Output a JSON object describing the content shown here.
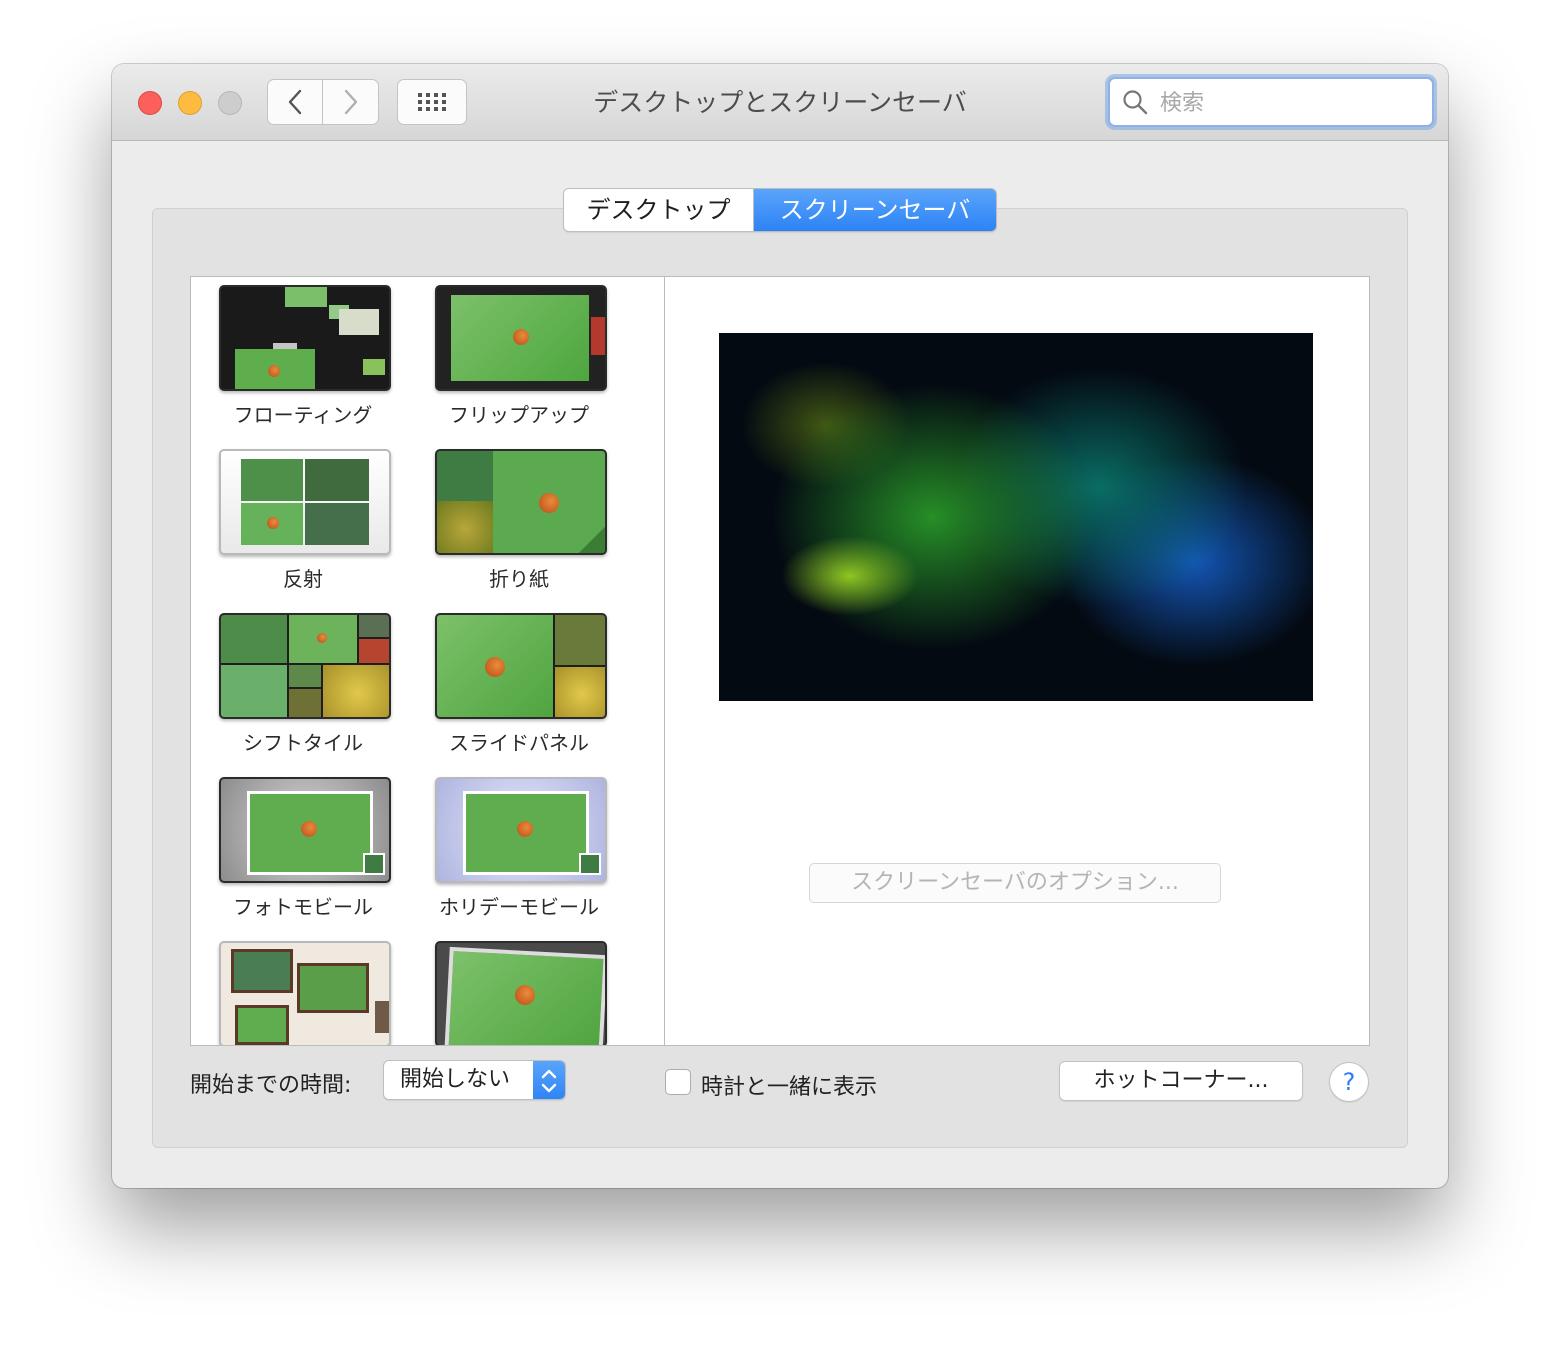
{
  "window": {
    "title": "デスクトップとスクリーンセーバ",
    "search_placeholder": "検索"
  },
  "tabs": [
    {
      "label": "デスクトップ",
      "selected": false
    },
    {
      "label": "スクリーンセーバ",
      "selected": true
    }
  ],
  "savers": [
    {
      "label": "フローティング"
    },
    {
      "label": "フリップアップ"
    },
    {
      "label": "反射"
    },
    {
      "label": "折り紙"
    },
    {
      "label": "シフトタイル"
    },
    {
      "label": "スライドパネル"
    },
    {
      "label": "フォトモビール"
    },
    {
      "label": "ホリデーモビール"
    },
    {
      "label": ""
    },
    {
      "label": ""
    }
  ],
  "options_button": "スクリーンセーバのオプション...",
  "start_after": {
    "label": "開始までの時間:",
    "value": "開始しない"
  },
  "show_clock": {
    "label": "時計と一緒に表示",
    "checked": false
  },
  "hot_corners_button": "ホットコーナー...",
  "help_button": "?",
  "colors": {
    "accent": "#2d83f5",
    "close": "#fc605c",
    "minimize": "#fdbc40",
    "zoom": "#cdcdcd"
  }
}
